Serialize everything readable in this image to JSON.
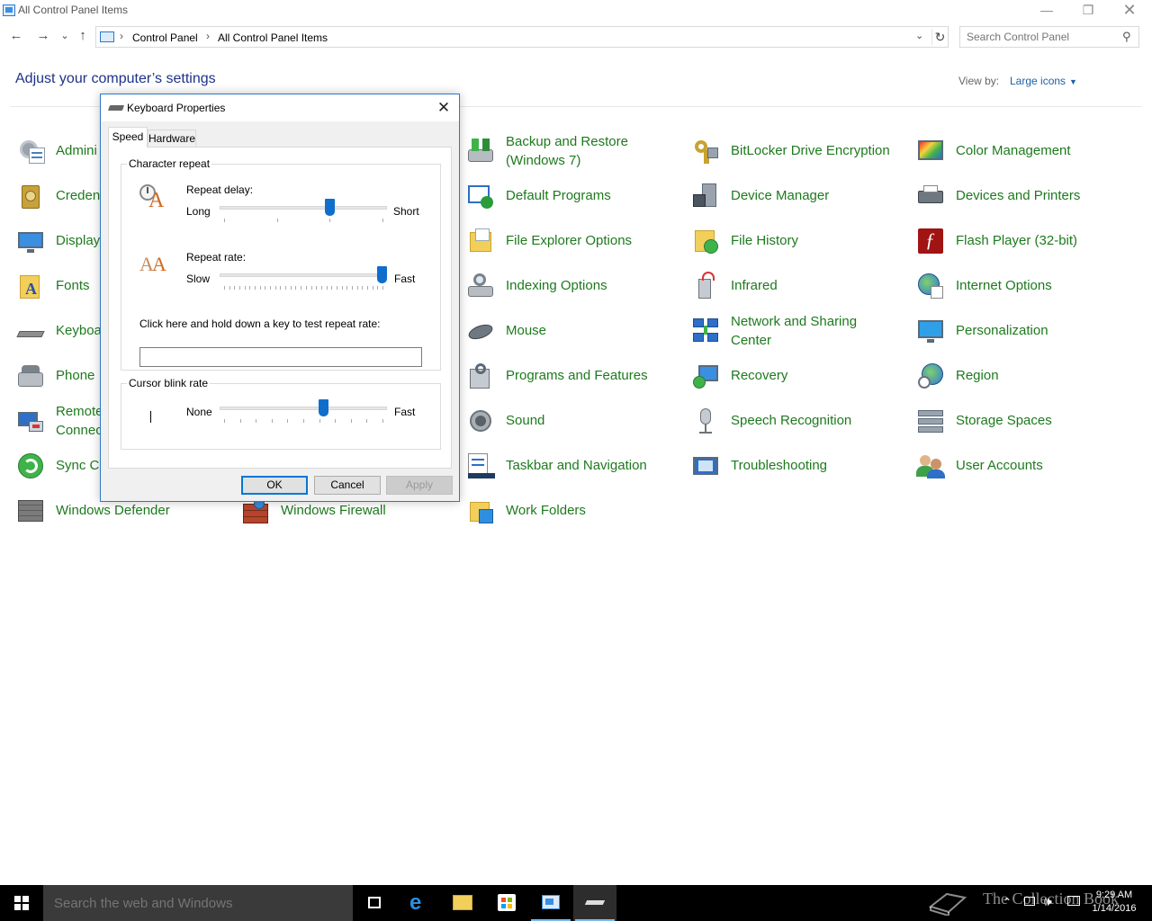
{
  "window": {
    "title": "All Control Panel Items",
    "min_glyph": "—",
    "max_glyph": "❐",
    "close_glyph": "✕"
  },
  "nav": {
    "back_glyph": "←",
    "forward_glyph": "→",
    "recent_glyph": "⌄",
    "up_glyph": "↑",
    "breadcrumbs": [
      "Control Panel",
      "All Control Panel Items"
    ],
    "separator": "›",
    "dropdown_glyph": "⌄",
    "refresh_glyph": "↻",
    "search_placeholder": "Search Control Panel",
    "search_glyph": "⚲"
  },
  "header": {
    "title": "Adjust your computer’s settings",
    "view_by_label": "View by:",
    "view_by_value": "Large icons",
    "view_by_caret": "▼"
  },
  "items": [
    {
      "label": "Admini",
      "icon": "admin-tools-icon"
    },
    {
      "label": "Creden",
      "icon": "credential-manager-icon"
    },
    {
      "label": "Display",
      "icon": "display-icon"
    },
    {
      "label": "Fonts",
      "icon": "fonts-icon"
    },
    {
      "label": "Keyboa",
      "icon": "keyboard-icon"
    },
    {
      "label": "Phone",
      "icon": "phone-modem-icon"
    },
    {
      "label": "Remote\nConnec",
      "icon": "remoteapp-icon"
    },
    {
      "label": "Sync C",
      "icon": "sync-center-icon"
    },
    {
      "label": "Windows Defender",
      "icon": "windows-defender-icon"
    },
    {
      "label": "Windows Firewall",
      "icon": "windows-firewall-icon"
    },
    {
      "label": "Backup and Restore\n(Windows 7)",
      "icon": "backup-restore-icon"
    },
    {
      "label": "Default Programs",
      "icon": "default-programs-icon"
    },
    {
      "label": "File Explorer Options",
      "icon": "file-explorer-options-icon"
    },
    {
      "label": "Indexing Options",
      "icon": "indexing-options-icon"
    },
    {
      "label": "Mouse",
      "icon": "mouse-icon"
    },
    {
      "label": "Programs and Features",
      "icon": "programs-features-icon"
    },
    {
      "label": "Sound",
      "icon": "sound-icon"
    },
    {
      "label": "Taskbar and Navigation",
      "icon": "taskbar-navigation-icon"
    },
    {
      "label": "Work Folders",
      "icon": "work-folders-icon"
    },
    {
      "label": "BitLocker Drive Encryption",
      "icon": "bitlocker-icon"
    },
    {
      "label": "Device Manager",
      "icon": "device-manager-icon"
    },
    {
      "label": "File History",
      "icon": "file-history-icon"
    },
    {
      "label": "Infrared",
      "icon": "infrared-icon"
    },
    {
      "label": "Network and Sharing\nCenter",
      "icon": "network-sharing-icon"
    },
    {
      "label": "Recovery",
      "icon": "recovery-icon"
    },
    {
      "label": "Speech Recognition",
      "icon": "speech-recognition-icon"
    },
    {
      "label": "Troubleshooting",
      "icon": "troubleshooting-icon"
    },
    {
      "label": "Color Management",
      "icon": "color-management-icon"
    },
    {
      "label": "Devices and Printers",
      "icon": "devices-printers-icon"
    },
    {
      "label": "Flash Player (32-bit)",
      "icon": "flash-player-icon"
    },
    {
      "label": "Internet Options",
      "icon": "internet-options-icon"
    },
    {
      "label": "Personalization",
      "icon": "personalization-icon"
    },
    {
      "label": "Region",
      "icon": "region-icon"
    },
    {
      "label": "Storage Spaces",
      "icon": "storage-spaces-icon"
    },
    {
      "label": "User Accounts",
      "icon": "user-accounts-icon"
    }
  ],
  "dialog": {
    "title": "Keyboard Properties",
    "close_glyph": "✕",
    "tabs": [
      "Speed",
      "Hardware"
    ],
    "active_tab": "Speed",
    "character_repeat": {
      "group_title": "Character repeat",
      "repeat_delay": {
        "label": "Repeat delay:",
        "min_label": "Long",
        "max_label": "Short",
        "value": 0.67
      },
      "repeat_rate": {
        "label": "Repeat rate:",
        "min_label": "Slow",
        "max_label": "Fast",
        "value": 1.0
      },
      "test_label": "Click here and hold down a key to test repeat rate:",
      "test_value": ""
    },
    "cursor_blink": {
      "group_title": "Cursor blink rate",
      "min_label": "None",
      "max_label": "Fast",
      "value": 0.63
    },
    "buttons": {
      "ok": "OK",
      "cancel": "Cancel",
      "apply": "Apply"
    }
  },
  "taskbar": {
    "search_placeholder": "Search the web and Windows",
    "time": "9:29 AM",
    "date": "1/14/2016",
    "watermark": "The Collection Book"
  },
  "colors": {
    "link_green": "#1d7a1d",
    "heading_blue": "#1e3287",
    "accent": "#0078d7"
  }
}
